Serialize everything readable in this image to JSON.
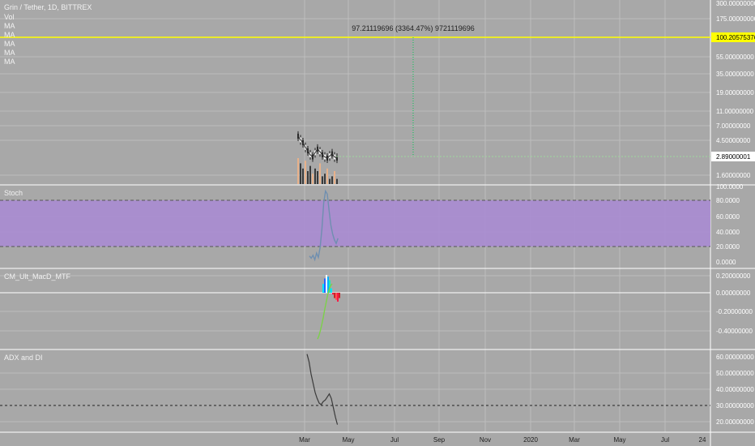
{
  "header": {
    "symbol": "Grin / Tether, 1D, BITTREX",
    "indicators": [
      "Vol",
      "MA",
      "MA",
      "MA",
      "MA",
      "MA"
    ]
  },
  "colors": {
    "background": "#a8a8a8",
    "grid": "#bdbdbd",
    "highlight_line": "#ffff00",
    "stoch_band": "#a98bd2",
    "measure_line": "#00c853",
    "price_line": "#2f2f2f"
  },
  "measure_label": "97.21119696 (3364.47%) 9721119696",
  "x_axis": {
    "ticks": [
      "Mar",
      "May",
      "Jul",
      "Sep",
      "Nov",
      "2020",
      "Mar",
      "May",
      "Jul",
      "24"
    ]
  },
  "chart_data": [
    {
      "name": "price",
      "type": "line",
      "scale": "log",
      "y_ticks": [
        "300.00000000",
        "175.00000000",
        "100.20575376",
        "55.00000000",
        "35.00000000",
        "19.00000000",
        "11.00000000",
        "7.00000000",
        "4.50000000",
        "2.89000001",
        "1.60000000"
      ],
      "highlight_value": "100.20575376",
      "last_value": "2.89000001",
      "closes": [
        5.6,
        5.0,
        4.6,
        4.0,
        3.6,
        3.2,
        3.0,
        3.4,
        3.8,
        3.5,
        3.2,
        3.0,
        2.9,
        3.1,
        3.3,
        3.0,
        2.89
      ],
      "volume": [
        1.0,
        0.8,
        0.6,
        0.9,
        0.5,
        0.7,
        0.4,
        0.6,
        0.5,
        0.8,
        0.3,
        0.4,
        0.6,
        0.2,
        0.3,
        0.5,
        0.2
      ]
    },
    {
      "name": "Stoch",
      "type": "line",
      "y_ticks": [
        "100.0000",
        "80.0000",
        "60.0000",
        "40.0000",
        "20.0000",
        "0.0000"
      ],
      "band": [
        20,
        80
      ],
      "values": [
        8,
        5,
        9,
        3,
        12,
        6,
        20,
        45,
        80,
        96,
        92,
        70,
        50,
        38,
        30,
        25,
        32
      ]
    },
    {
      "name": "CM_Ult_MacD_MTF",
      "type": "histogram",
      "y_ticks": [
        "0.20000000",
        "0.00000000",
        "-0.20000000",
        "-0.40000000"
      ],
      "line": [
        -0.52,
        -0.48,
        -0.42,
        -0.35,
        -0.27,
        -0.18,
        -0.1,
        -0.02,
        0.04,
        0.08,
        0.1
      ],
      "histogram": [
        0.1,
        0.16,
        0.2,
        0.18,
        0.14,
        0.05,
        -0.02,
        -0.06,
        -0.08,
        -0.1,
        -0.06
      ]
    },
    {
      "name": "ADX and DI",
      "type": "line",
      "y_ticks": [
        "60.00000000",
        "50.00000000",
        "40.00000000",
        "30.00000000",
        "20.00000000"
      ],
      "reference": 30,
      "values": [
        63,
        58,
        50,
        44,
        38,
        34,
        31,
        30,
        32,
        33,
        35,
        37,
        34,
        28,
        22,
        17
      ]
    }
  ]
}
